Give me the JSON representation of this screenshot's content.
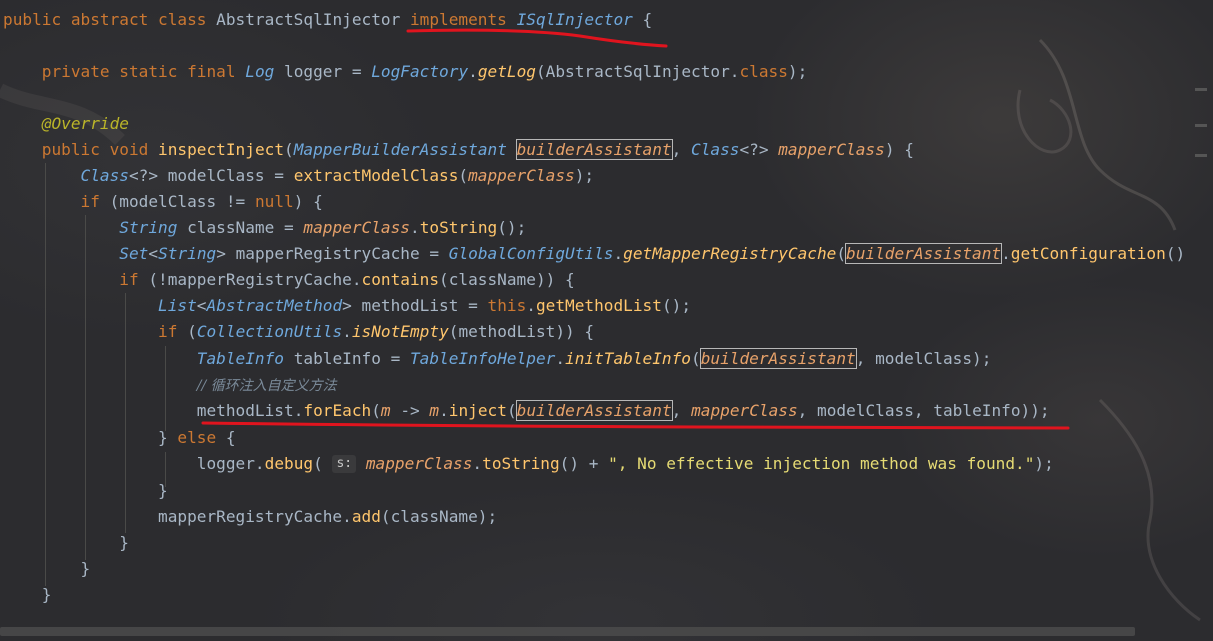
{
  "editor": {
    "lines": [
      [
        [
          "kw",
          "public abstract class "
        ],
        [
          "cls",
          "AbstractSqlInjector "
        ],
        [
          "kw",
          "implements "
        ],
        [
          "ityp",
          "ISqlInjector"
        ],
        [
          "pun",
          " {"
        ]
      ],
      [],
      [
        [
          "pun",
          "    "
        ],
        [
          "kw",
          "private static final "
        ],
        [
          "ityp",
          "Log "
        ],
        [
          "par",
          "logger "
        ],
        [
          "pun",
          "= "
        ],
        [
          "ityp",
          "LogFactory"
        ],
        [
          "pun",
          "."
        ],
        [
          "ifn",
          "getLog"
        ],
        [
          "pun",
          "(AbstractSqlInjector."
        ],
        [
          "kw",
          "class"
        ],
        [
          "pun",
          ");"
        ]
      ],
      [],
      [
        [
          "pun",
          "    "
        ],
        [
          "ann",
          "@Override"
        ]
      ],
      [
        [
          "pun",
          "    "
        ],
        [
          "kw",
          "public void "
        ],
        [
          "fn",
          "inspectInject"
        ],
        [
          "pun",
          "("
        ],
        [
          "ityp",
          "MapperBuilderAssistant "
        ],
        [
          "ipar",
          "builderAssistant",
          "box"
        ],
        [
          "pun",
          ", "
        ],
        [
          "ityp",
          "Class"
        ],
        [
          "pun",
          "<?> "
        ],
        [
          "ipar",
          "mapperClass"
        ],
        [
          "pun",
          ") {"
        ]
      ],
      [
        [
          "pun",
          "        "
        ],
        [
          "ityp",
          "Class"
        ],
        [
          "pun",
          "<?> modelClass = "
        ],
        [
          "fn",
          "extractModelClass"
        ],
        [
          "pun",
          "("
        ],
        [
          "ipar",
          "mapperClass"
        ],
        [
          "pun",
          ");"
        ]
      ],
      [
        [
          "pun",
          "        "
        ],
        [
          "kw",
          "if "
        ],
        [
          "pun",
          "(modelClass != "
        ],
        [
          "kw",
          "null"
        ],
        [
          "pun",
          ") {"
        ]
      ],
      [
        [
          "pun",
          "            "
        ],
        [
          "ityp",
          "String "
        ],
        [
          "pun",
          "className = "
        ],
        [
          "ipar",
          "mapperClass"
        ],
        [
          "pun",
          "."
        ],
        [
          "fn",
          "toString"
        ],
        [
          "pun",
          "();"
        ]
      ],
      [
        [
          "pun",
          "            "
        ],
        [
          "ityp",
          "Set"
        ],
        [
          "pun",
          "<"
        ],
        [
          "ityp",
          "String"
        ],
        [
          "pun",
          "> mapperRegistryCache = "
        ],
        [
          "ityp",
          "GlobalConfigUtils"
        ],
        [
          "pun",
          "."
        ],
        [
          "ifn",
          "getMapperRegistryCache"
        ],
        [
          "pun",
          "("
        ],
        [
          "ipar",
          "builderAssistant",
          "box"
        ],
        [
          "pun",
          "."
        ],
        [
          "fn",
          "getConfiguration"
        ],
        [
          "pun",
          "()"
        ]
      ],
      [
        [
          "pun",
          "            "
        ],
        [
          "kw",
          "if "
        ],
        [
          "pun",
          "(!mapperRegistryCache."
        ],
        [
          "fn",
          "contains"
        ],
        [
          "pun",
          "(className)) {"
        ]
      ],
      [
        [
          "pun",
          "                "
        ],
        [
          "ityp",
          "List"
        ],
        [
          "pun",
          "<"
        ],
        [
          "ityp",
          "AbstractMethod"
        ],
        [
          "pun",
          "> methodList = "
        ],
        [
          "kw",
          "this"
        ],
        [
          "pun",
          "."
        ],
        [
          "fn",
          "getMethodList"
        ],
        [
          "pun",
          "();"
        ]
      ],
      [
        [
          "pun",
          "                "
        ],
        [
          "kw",
          "if "
        ],
        [
          "pun",
          "("
        ],
        [
          "ityp",
          "CollectionUtils"
        ],
        [
          "pun",
          "."
        ],
        [
          "ifn",
          "isNotEmpty"
        ],
        [
          "pun",
          "(methodList)) {"
        ]
      ],
      [
        [
          "pun",
          "                    "
        ],
        [
          "ityp",
          "TableInfo "
        ],
        [
          "pun",
          "tableInfo = "
        ],
        [
          "ityp",
          "TableInfoHelper"
        ],
        [
          "pun",
          "."
        ],
        [
          "ifn",
          "initTableInfo"
        ],
        [
          "pun",
          "("
        ],
        [
          "ipar",
          "builderAssistant",
          "box"
        ],
        [
          "pun",
          ", modelClass);"
        ]
      ],
      [
        [
          "pun",
          "                    "
        ],
        [
          "cmt",
          "// 循环注入自定义方法"
        ]
      ],
      [
        [
          "pun",
          "                    "
        ],
        [
          "pun",
          "methodList."
        ],
        [
          "fn",
          "forEach"
        ],
        [
          "pun",
          "("
        ],
        [
          "ipar",
          "m "
        ],
        [
          "pun",
          "-> "
        ],
        [
          "ipar",
          "m"
        ],
        [
          "pun",
          "."
        ],
        [
          "fn",
          "inject"
        ],
        [
          "pun",
          "("
        ],
        [
          "ipar",
          "builderAssistant",
          "box"
        ],
        [
          "pun",
          ", "
        ],
        [
          "ipar",
          "mapperClass"
        ],
        [
          "pun",
          ", modelClass, tableInfo));"
        ]
      ],
      [
        [
          "pun",
          "                "
        ],
        [
          "pun",
          "} "
        ],
        [
          "kw",
          "else "
        ],
        [
          "pun",
          "{"
        ]
      ],
      [
        [
          "pun",
          "                    logger."
        ],
        [
          "fn",
          "debug"
        ],
        [
          "pun",
          "( "
        ],
        [
          "hint",
          "s:"
        ],
        [
          "pun",
          " "
        ],
        [
          "ipar",
          "mapperClass"
        ],
        [
          "pun",
          "."
        ],
        [
          "fn",
          "toString"
        ],
        [
          "pun",
          "() + "
        ],
        [
          "str",
          "\", No effective injection method was found.\""
        ],
        [
          "pun",
          ");"
        ]
      ],
      [
        [
          "pun",
          "                }"
        ]
      ],
      [
        [
          "pun",
          "                mapperRegistryCache."
        ],
        [
          "fn",
          "add"
        ],
        [
          "pun",
          "(className);"
        ]
      ],
      [
        [
          "pun",
          "            }"
        ]
      ],
      [
        [
          "pun",
          "        }"
        ]
      ],
      [
        [
          "pun",
          "    }"
        ]
      ]
    ],
    "inlay_hint": "s:"
  },
  "annotations": {
    "underline_color": "#e0141e"
  }
}
